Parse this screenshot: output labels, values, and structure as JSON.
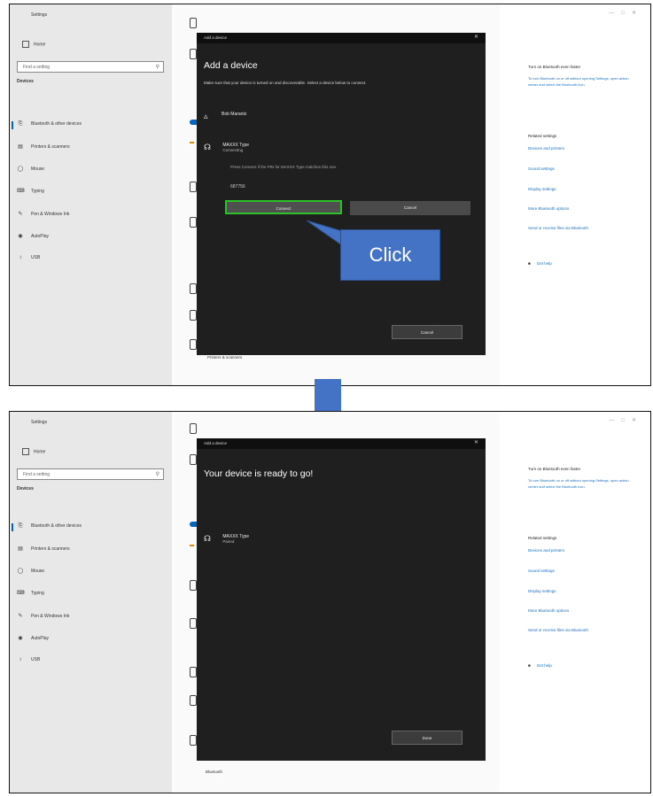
{
  "panels": {
    "top": {
      "app_title": "Settings",
      "home_label": "Home",
      "search_placeholder": "Find a setting",
      "section_heading": "Devices",
      "sidebar_items": [
        {
          "label": "Bluetooth & other devices",
          "icon": "bluetooth-devices-icon"
        },
        {
          "label": "Printers & scanners",
          "icon": "printer-icon"
        },
        {
          "label": "Mouse",
          "icon": "mouse-icon"
        },
        {
          "label": "Typing",
          "icon": "keyboard-icon"
        },
        {
          "label": "Pen & Windows Ink",
          "icon": "pen-icon"
        },
        {
          "label": "AutoPlay",
          "icon": "autoplay-icon"
        },
        {
          "label": "USB",
          "icon": "usb-icon"
        }
      ],
      "dialog": {
        "title": "Add a device",
        "heading": "Add a device",
        "subtext": "Make sure that your device is turned on and discoverable. Select a device below to connect.",
        "devices": [
          {
            "name": "Bob Marantz",
            "status": ""
          },
          {
            "name": "MAXXX Type",
            "status": "Connecting"
          }
        ],
        "pin_note": "Press Connect if the PIN for MAXXX Type matches this one.",
        "pin_code": "687756",
        "connect_label": "Connect",
        "cancel_pair_label": "Cancel",
        "bottom_button_label": "Cancel"
      },
      "right_panel": {
        "heading": "Turn on Bluetooth even faster",
        "desc": "To turn Bluetooth on or off without opening Settings, open action center and select the Bluetooth icon.",
        "related_heading": "Related settings",
        "links": [
          "Devices and printers",
          "Sound settings",
          "Display settings",
          "More Bluetooth options",
          "Send or receive files via Bluetooth"
        ],
        "help": "Get help"
      },
      "middle_fragment_bottom": "Printers & scanners"
    },
    "bottom": {
      "app_title": "Settings",
      "home_label": "Home",
      "search_placeholder": "Find a setting",
      "section_heading": "Devices",
      "sidebar_items": [
        {
          "label": "Bluetooth & other devices",
          "icon": "bluetooth-devices-icon"
        },
        {
          "label": "Printers & scanners",
          "icon": "printer-icon"
        },
        {
          "label": "Mouse",
          "icon": "mouse-icon"
        },
        {
          "label": "Typing",
          "icon": "keyboard-icon"
        },
        {
          "label": "Pen & Windows Ink",
          "icon": "pen-icon"
        },
        {
          "label": "AutoPlay",
          "icon": "autoplay-icon"
        },
        {
          "label": "USB",
          "icon": "usb-icon"
        }
      ],
      "dialog": {
        "title": "Add a device",
        "heading": "Your device is ready to go!",
        "devices": [
          {
            "name": "MAXXX Type",
            "status": "Paired"
          }
        ],
        "bottom_button_label": "Done"
      },
      "right_panel": {
        "heading": "Turn on Bluetooth even faster",
        "desc": "To turn Bluetooth on or off without opening Settings, open action center and select the Bluetooth icon.",
        "related_heading": "Related settings",
        "links": [
          "Devices and printers",
          "Sound settings",
          "Display settings",
          "More Bluetooth options",
          "Send or receive files via Bluetooth"
        ],
        "help": "Get help"
      },
      "middle_fragment_bottom": "Bluetooth"
    }
  },
  "callout": {
    "text": "Click",
    "color": "#4472c4"
  },
  "colors": {
    "dialog_bg": "#1f1f1f",
    "highlight": "#2bc12b",
    "accent": "#0067c0"
  }
}
